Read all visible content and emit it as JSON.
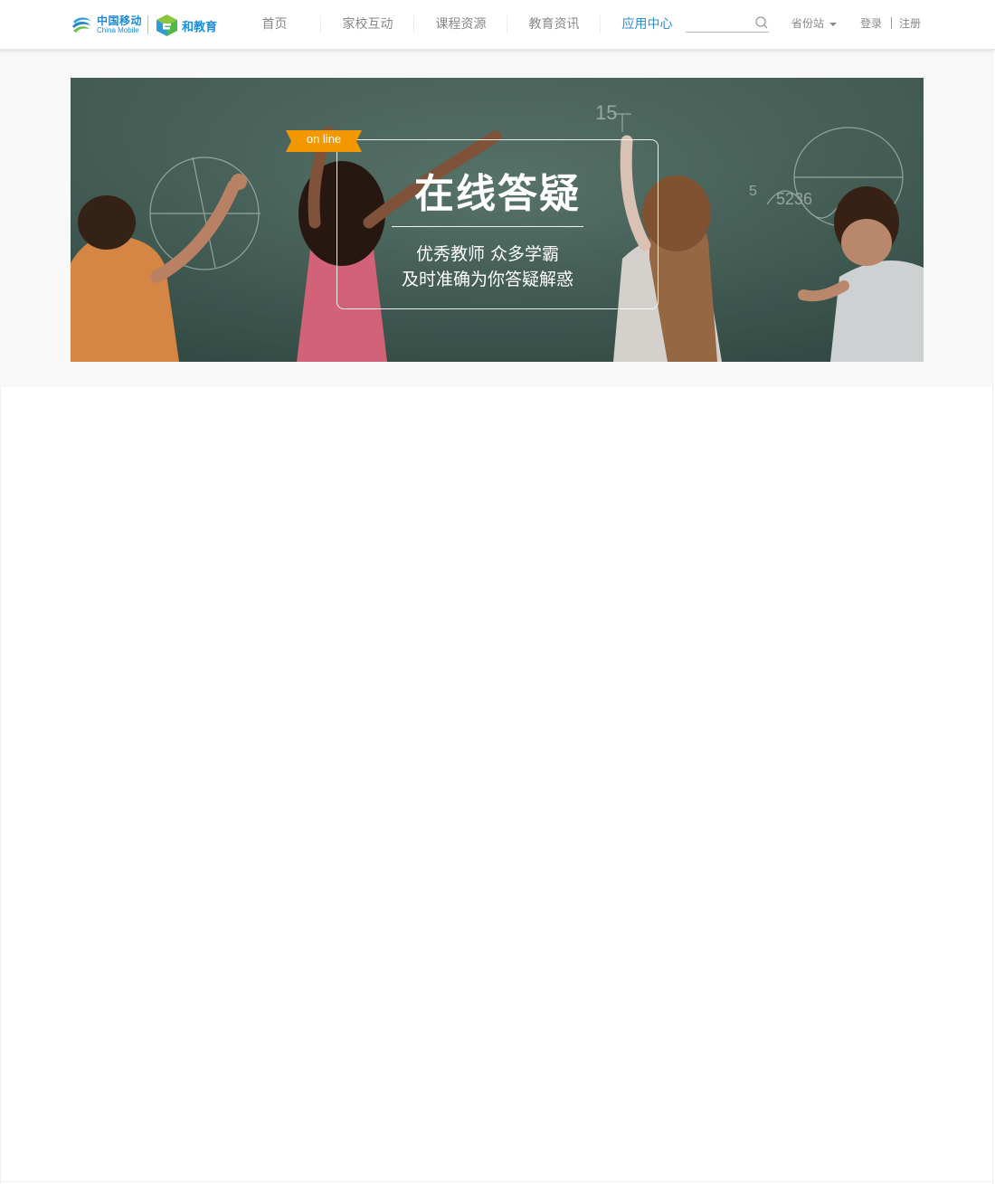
{
  "brand": {
    "china_mobile_cn": "中国移动",
    "china_mobile_en": "China Mobile",
    "edu_name": "和教育"
  },
  "nav": {
    "items": [
      {
        "label": "首页"
      },
      {
        "label": "家校互动"
      },
      {
        "label": "课程资源"
      },
      {
        "label": "教育资讯"
      },
      {
        "label": "应用中心"
      }
    ],
    "active_index": 4
  },
  "search": {
    "value": "",
    "placeholder": ""
  },
  "province": {
    "label": "省份站"
  },
  "auth": {
    "login": "登录",
    "register": "注册"
  },
  "banner": {
    "ribbon": "on line",
    "title": "在线答疑",
    "line1": "优秀教师 众多学霸",
    "line2": "及时准确为你答疑解惑"
  },
  "colors": {
    "accent": "#2b8fd6",
    "ribbon": "#f39800",
    "chalkboard": "#4a675e"
  }
}
